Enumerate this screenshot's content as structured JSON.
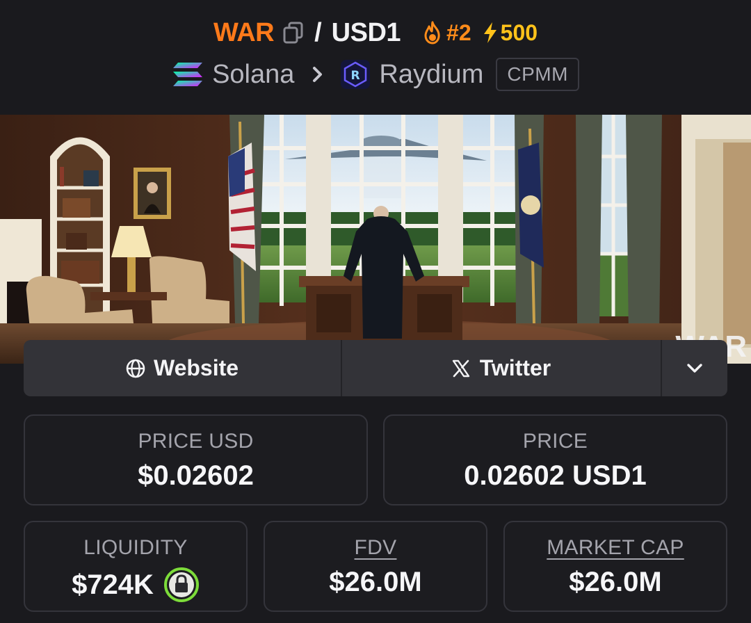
{
  "header": {
    "base_symbol": "WAR",
    "slash": "/",
    "quote_symbol": "USD1",
    "trending_rank": "#2",
    "boosts": "500",
    "chain": "Solana",
    "dex": "Raydium",
    "pool_type": "CPMM",
    "icons": [
      "copy-icon",
      "fire-icon",
      "bolt-icon",
      "solana-icon",
      "chevron-right-icon",
      "raydium-icon"
    ]
  },
  "banner": {
    "watermark": "WAR",
    "description_icons": [
      "oval-office-scene"
    ]
  },
  "links": {
    "website_label": "Website",
    "twitter_label": "Twitter",
    "icons": [
      "globe-icon",
      "x-icon",
      "chevron-down-icon"
    ]
  },
  "stats": {
    "price_usd": {
      "label": "PRICE USD",
      "value": "$0.02602"
    },
    "price": {
      "label": "PRICE",
      "value": "0.02602 USD1"
    },
    "liquidity": {
      "label": "LIQUIDITY",
      "value": "$724K",
      "locked": true
    },
    "fdv": {
      "label": "FDV",
      "value": "$26.0M"
    },
    "market_cap": {
      "label": "MARKET CAP",
      "value": "$26.0M"
    }
  },
  "colors": {
    "background": "#1a1a1e",
    "base_symbol": "#ff7a1a",
    "trending": "#ff8c1a",
    "boost": "#ffc21a",
    "lock": "#7ddc3a",
    "card_border": "#34343b",
    "links_bar": "#333338"
  }
}
